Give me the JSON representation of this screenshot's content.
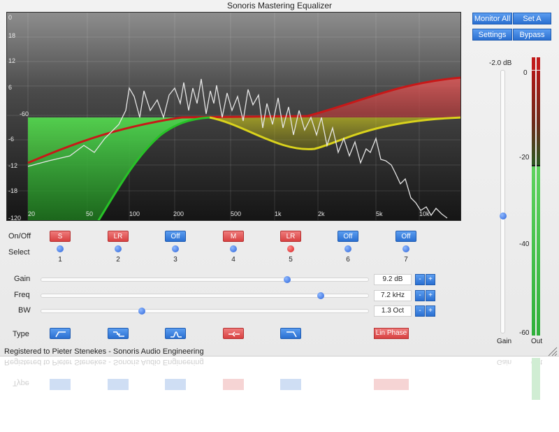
{
  "window": {
    "title": "Sonoris Mastering Equalizer"
  },
  "display": {
    "db_labels": [
      "0",
      "18",
      "12",
      "6",
      "-60",
      "-6",
      "-12",
      "-18",
      "-120"
    ],
    "freq_labels": [
      "20",
      "50",
      "100",
      "200",
      "500",
      "1k",
      "2k",
      "5k",
      "10k"
    ]
  },
  "top_buttons": {
    "monitor_all": "Monitor All",
    "set_a": "Set A",
    "settings": "Settings",
    "bypass": "Bypass"
  },
  "master": {
    "gain_value": "-2.0 dB",
    "gain_label": "Gain",
    "out_label": "Out",
    "gain_level_fraction": 0.55,
    "meter_labels": [
      "0",
      "-20",
      "-40",
      "-60"
    ]
  },
  "bands": {
    "on_off_label": "On/Off",
    "select_label": "Select",
    "states": [
      "S",
      "LR",
      "Off",
      "M",
      "LR",
      "Off",
      "Off"
    ],
    "state_colors": [
      "red",
      "red",
      "blue",
      "red",
      "red",
      "blue",
      "blue"
    ],
    "numbers": [
      "1",
      "2",
      "3",
      "4",
      "5",
      "6",
      "7"
    ],
    "selected_band": 5
  },
  "params": {
    "gain": {
      "label": "Gain",
      "value": "9.2 dB",
      "position": 0.75
    },
    "freq": {
      "label": "Freq",
      "value": "7.2 kHz",
      "position": 0.85
    },
    "bw": {
      "label": "BW",
      "value": "1.3 Oct",
      "position": 0.31
    },
    "minus": "-",
    "plus": "+"
  },
  "type": {
    "label": "Type",
    "filters": [
      "highpass",
      "low-shelf",
      "bell",
      "notch",
      "lowpass"
    ],
    "lin_phase": "Lin Phase"
  },
  "footer": {
    "registered": "Registered to Pieter Stenekes - Sonoris Audio Engineering"
  },
  "colors": {
    "accent_blue": "#2a6fd1",
    "accent_red": "#d84141",
    "curve_red": "#c81818",
    "curve_green": "#27c227",
    "curve_yellow": "#d9d21c"
  }
}
